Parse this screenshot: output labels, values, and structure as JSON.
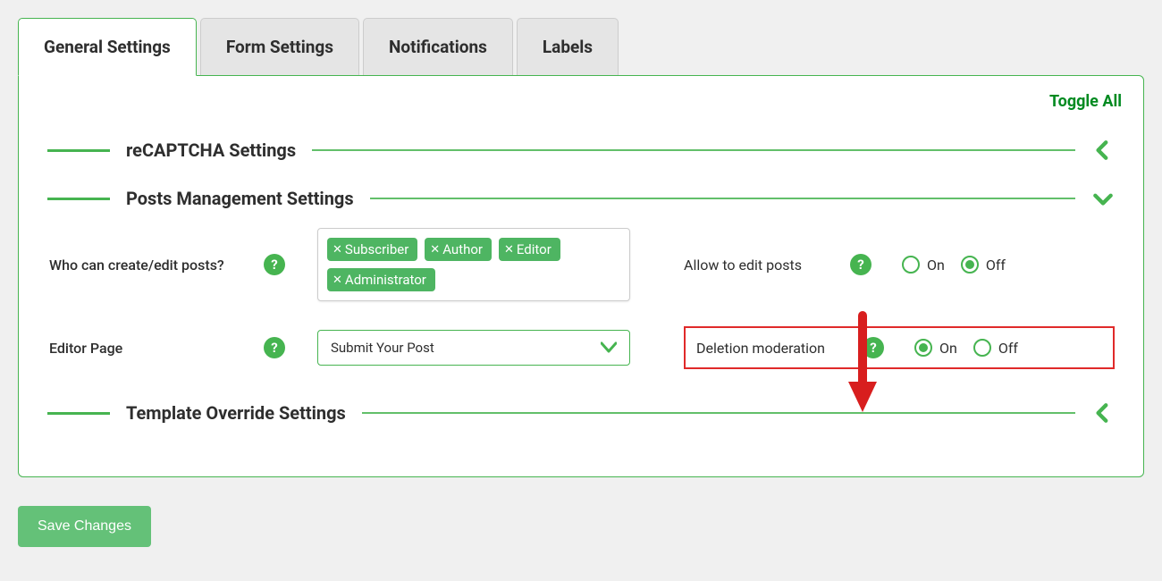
{
  "tabs": {
    "general": "General Settings",
    "form": "Form Settings",
    "notifications": "Notifications",
    "labels": "Labels"
  },
  "toggle_all": "Toggle All",
  "sections": {
    "recaptcha": "reCAPTCHA Settings",
    "posts_mgmt": "Posts Management Settings",
    "template_override": "Template Override Settings"
  },
  "fields": {
    "who_can_edit": {
      "label": "Who can create/edit posts?",
      "tags": [
        "Subscriber",
        "Author",
        "Editor",
        "Administrator"
      ]
    },
    "allow_edit": {
      "label": "Allow to edit posts",
      "options": {
        "on": "On",
        "off": "Off"
      },
      "value": "off"
    },
    "editor_page": {
      "label": "Editor Page",
      "value": "Submit Your Post"
    },
    "deletion_moderation": {
      "label": "Deletion moderation",
      "options": {
        "on": "On",
        "off": "Off"
      },
      "value": "on"
    }
  },
  "buttons": {
    "save": "Save Changes"
  },
  "colors": {
    "accent": "#46b450",
    "highlight": "#e02a2a"
  }
}
